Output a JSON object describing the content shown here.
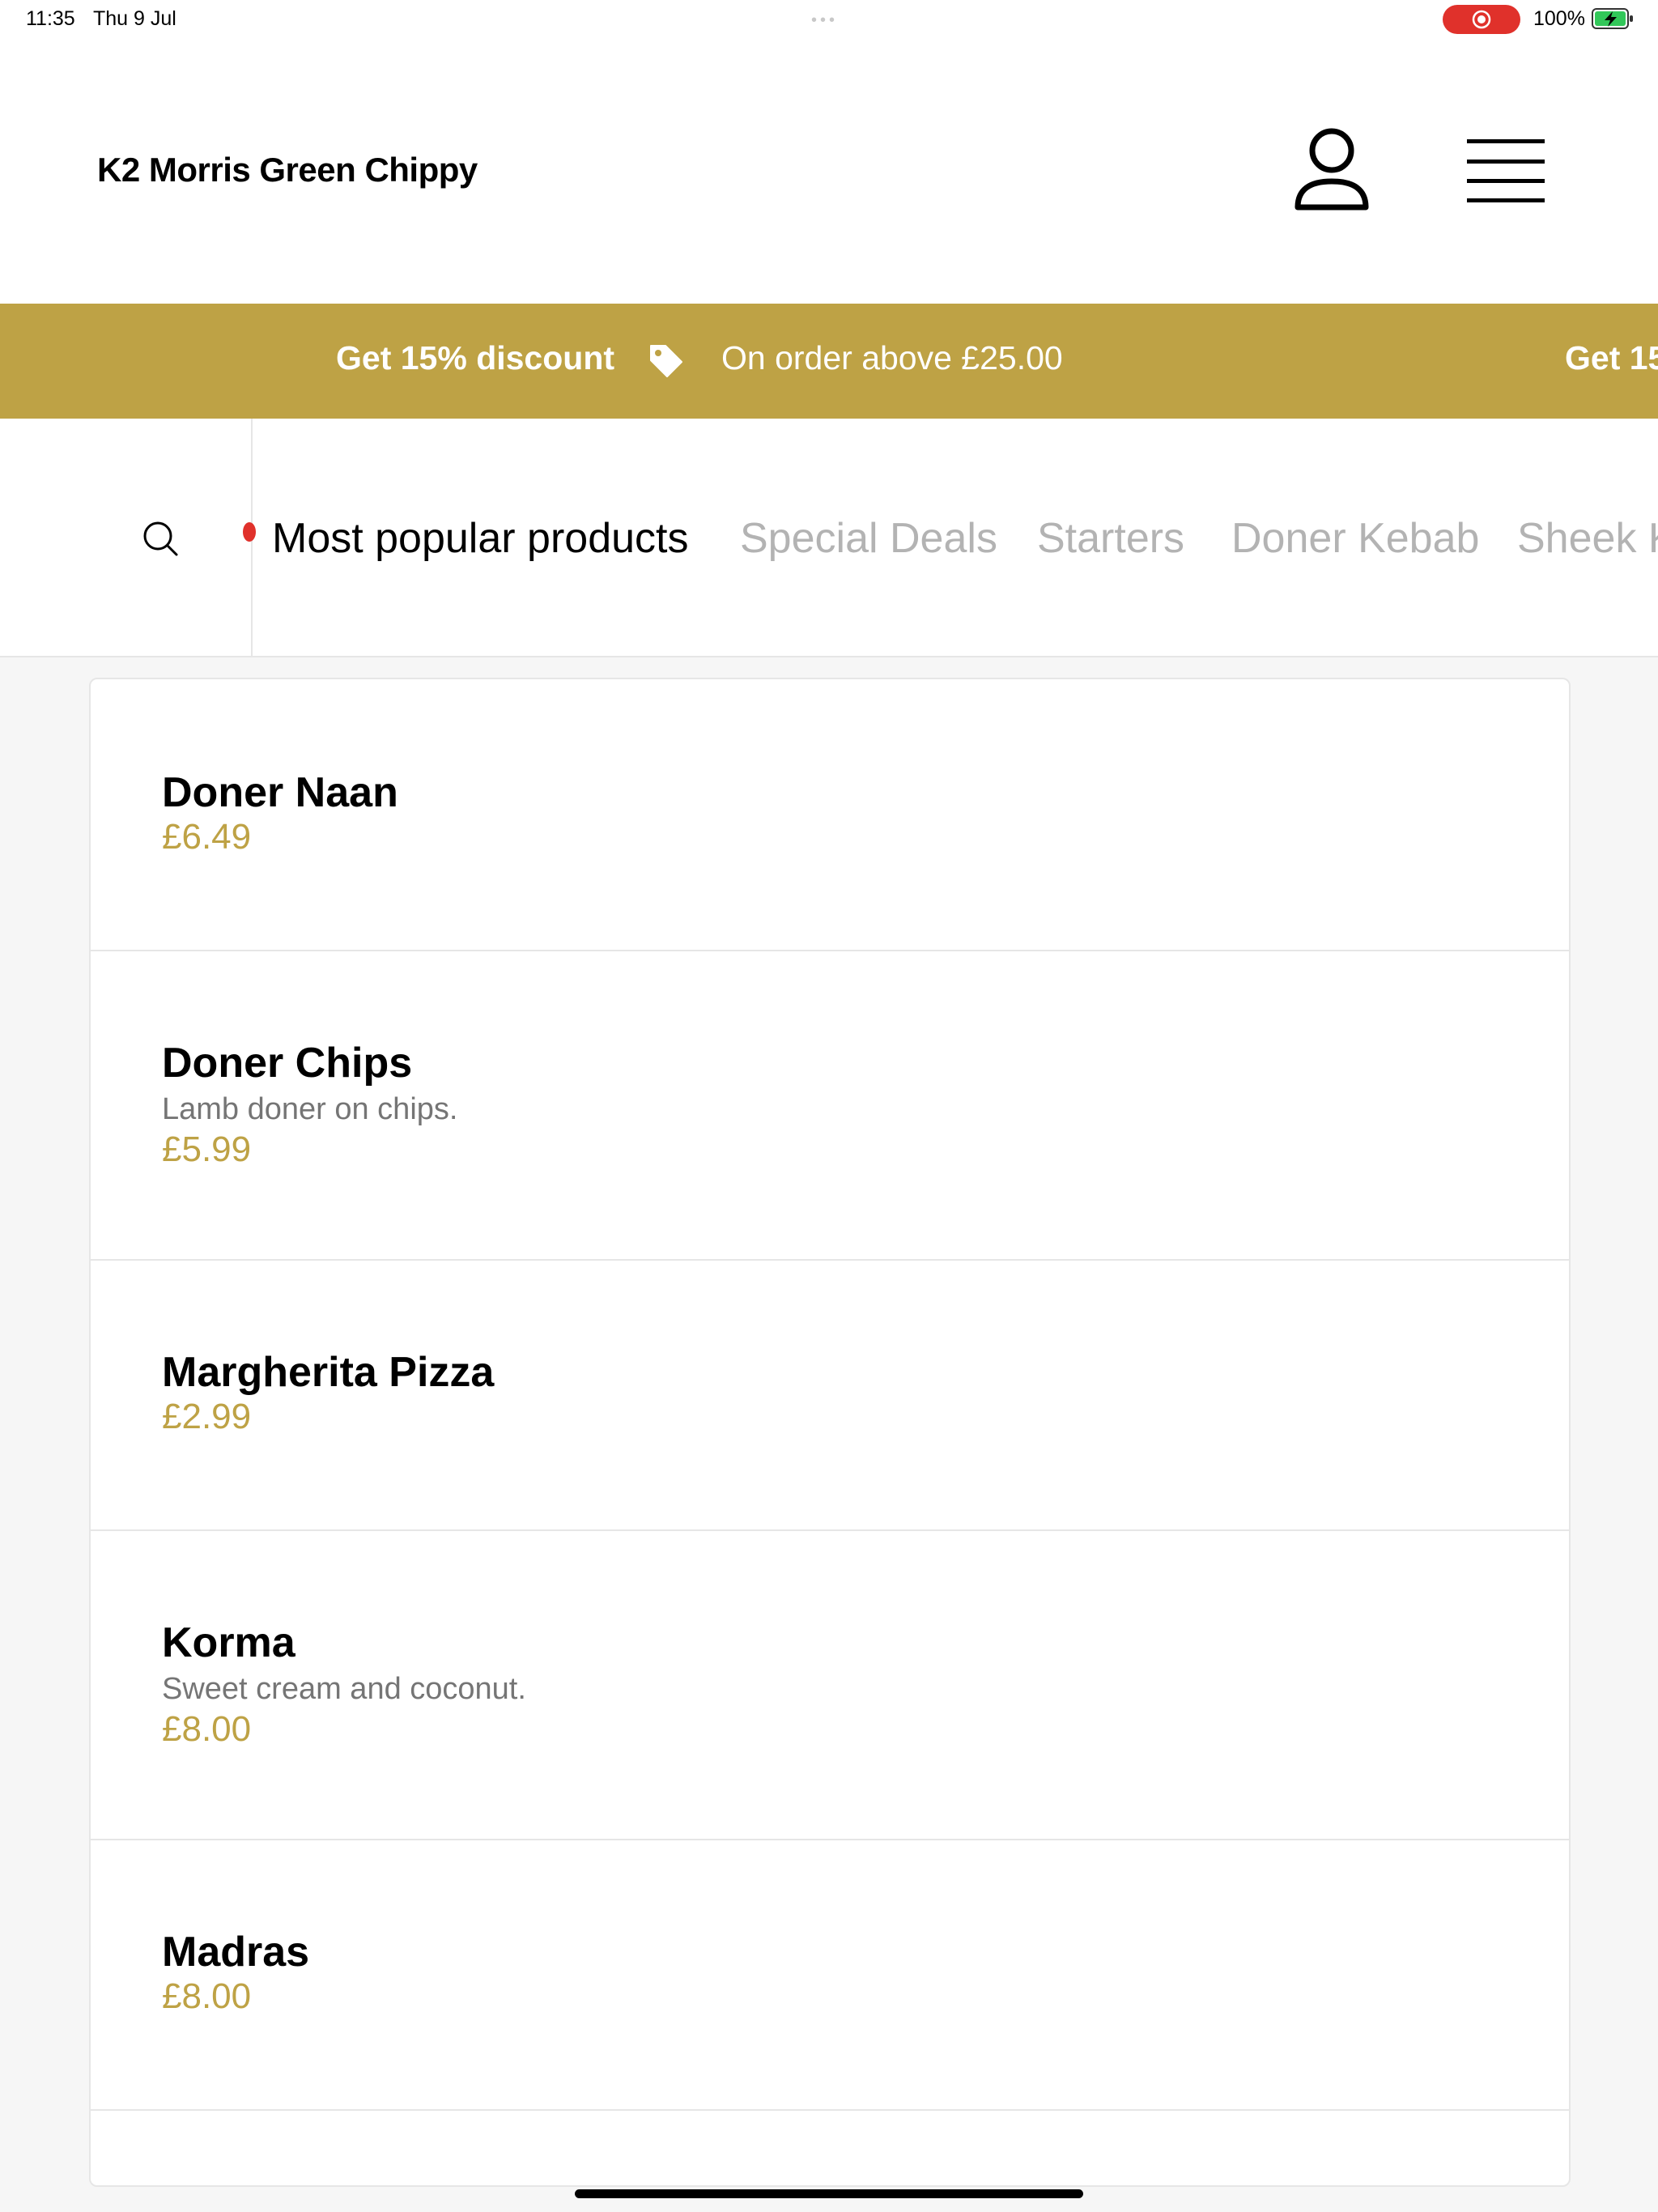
{
  "status_bar": {
    "time": "11:35",
    "date": "Thu 9 Jul",
    "multitask_dots": "•••",
    "battery_text": "100%"
  },
  "header": {
    "restaurant_name": "K2 Morris Green Chippy",
    "user_icon": "person-outline-icon",
    "menu_icon": "hamburger-menu-icon"
  },
  "promo": {
    "title": "Get 15% discount",
    "detail": "On order above £25.00",
    "repeat_title": "Get 15",
    "icon": "tag-icon",
    "background": "#bea245"
  },
  "categories": {
    "search_icon": "magnifier-icon",
    "items": [
      {
        "label": "Most popular products",
        "active": true
      },
      {
        "label": "Special Deals",
        "active": false
      },
      {
        "label": "Starters",
        "active": false
      },
      {
        "label": "Doner Kebab",
        "active": false
      },
      {
        "label": "Sheek K",
        "active": false
      }
    ]
  },
  "products": [
    {
      "name": "Doner Naan",
      "description": "",
      "price": "£6.49"
    },
    {
      "name": "Doner Chips",
      "description": "Lamb doner on chips.",
      "price": "£5.99"
    },
    {
      "name": "Margherita Pizza",
      "description": "",
      "price": "£2.99"
    },
    {
      "name": "Korma",
      "description": "Sweet cream and coconut.",
      "price": "£8.00"
    },
    {
      "name": "Madras",
      "description": "",
      "price": "£8.00"
    }
  ],
  "colors": {
    "accent": "#bea245",
    "recording": "#e0312b",
    "inactive_tab": "#b3b3b3"
  }
}
